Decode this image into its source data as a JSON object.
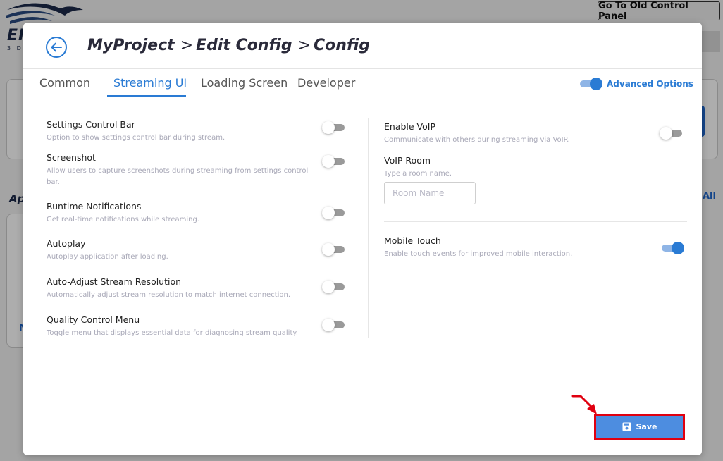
{
  "background": {
    "old_panel_button": "Go To Old Control Panel",
    "logo_text": "EI",
    "logo_sub": "3 D",
    "side_label": "Ap",
    "all_link": "All",
    "n_link": "N"
  },
  "header": {
    "breadcrumb": [
      "MyProject",
      "Edit Config",
      "Config"
    ],
    "separator": ">"
  },
  "tabs": [
    {
      "label": "Common",
      "active": false
    },
    {
      "label": "Streaming UI",
      "active": true
    },
    {
      "label": "Loading Screen",
      "active": false
    },
    {
      "label": "Developer",
      "active": false
    }
  ],
  "advanced_options": {
    "label": "Advanced Options",
    "enabled": true
  },
  "left_settings": [
    {
      "title": "Settings Control Bar",
      "desc": "Option to show settings control bar during stream.",
      "enabled": false
    },
    {
      "title": "Screenshot",
      "desc": "Allow users to capture screenshots during streaming from settings control bar.",
      "enabled": false
    },
    {
      "title": "Runtime Notifications",
      "desc": "Get real-time notifications while streaming.",
      "enabled": false
    },
    {
      "title": "Autoplay",
      "desc": "Autoplay application after loading.",
      "enabled": false
    },
    {
      "title": "Auto-Adjust Stream Resolution",
      "desc": "Automatically adjust stream resolution to match internet connection.",
      "enabled": false
    },
    {
      "title": "Quality Control Menu",
      "desc": "Toggle menu that displays essential data for diagnosing stream quality.",
      "enabled": false
    }
  ],
  "voip": {
    "title": "Enable VoIP",
    "desc": "Communicate with others during streaming via VoIP.",
    "enabled": false
  },
  "voip_room": {
    "title": "VoIP Room",
    "desc": "Type a room name.",
    "placeholder": "Room Name",
    "value": ""
  },
  "mobile_touch": {
    "title": "Mobile Touch",
    "desc": "Enable touch events for improved mobile interaction.",
    "enabled": true
  },
  "save_button": {
    "label": "Save"
  },
  "colors": {
    "accent": "#2a7bd4",
    "highlight": "#e00010",
    "save": "#4d8de0"
  }
}
